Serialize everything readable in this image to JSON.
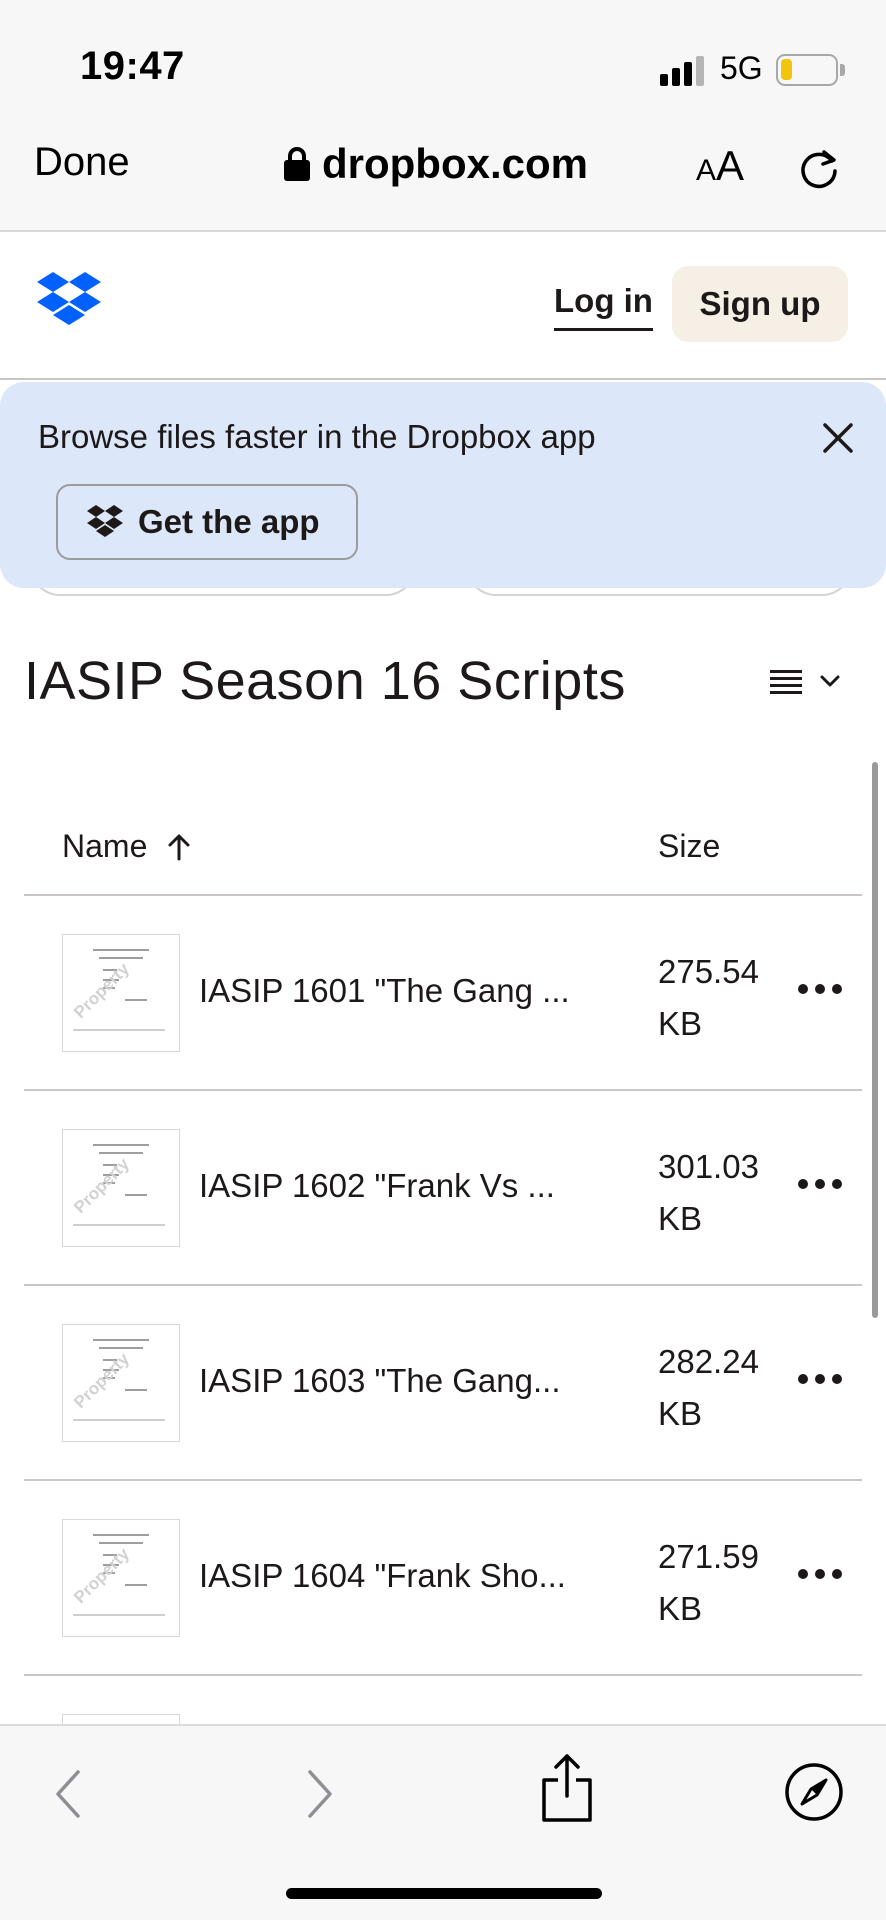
{
  "status_bar": {
    "time": "19:47",
    "network": "5G",
    "battery_level": 0.2,
    "battery_color": "#f2c40c"
  },
  "browser": {
    "done_label": "Done",
    "url": "dropbox.com",
    "text_size_small": "A",
    "text_size_large": "A",
    "lock_icon": "lock-icon",
    "reload_icon": "reload-icon"
  },
  "header": {
    "logo": "dropbox-logo",
    "brand_color": "#0061fe",
    "login_label": "Log in",
    "signup_label": "Sign up"
  },
  "app_banner": {
    "text": "Browse files faster in the Dropbox app",
    "button_label": "Get the app",
    "background": "#dce7f9"
  },
  "folder": {
    "title": "IASIP Season 16 Scripts"
  },
  "list": {
    "columns": {
      "name": "Name",
      "size": "Size",
      "sort_icon": "arrow-up-icon"
    },
    "files": [
      {
        "name": "IASIP 1601 \"The Gang ...",
        "size": "275.54 KB"
      },
      {
        "name": "IASIP 1602 \"Frank Vs ...",
        "size": "301.03 KB"
      },
      {
        "name": "IASIP 1603 \"The Gang...",
        "size": "282.24 KB"
      },
      {
        "name": "IASIP 1604 \"Frank Sho...",
        "size": "271.59 KB"
      }
    ]
  }
}
